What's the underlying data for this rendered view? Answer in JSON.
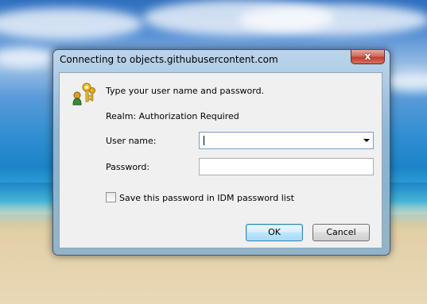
{
  "window": {
    "title": "Connecting to objects.githubusercontent.com",
    "close_label": "x"
  },
  "dialog": {
    "prompt": "Type your user name and password.",
    "realm": "Realm: Authorization Required",
    "username_label": "User name:",
    "username_value": "",
    "password_label": "Password:",
    "password_value": "",
    "save_password_label": "Save this password in IDM password list",
    "save_password_checked": false,
    "ok_label": "OK",
    "cancel_label": "Cancel"
  },
  "icons": {
    "dialog_icon": "key-user-icon",
    "close": "close-icon",
    "dropdown": "chevron-down-icon"
  },
  "colors": {
    "ok_border": "#3c7fb1",
    "close_button": "#c0402d",
    "client_bg": "#f0f0f0"
  }
}
